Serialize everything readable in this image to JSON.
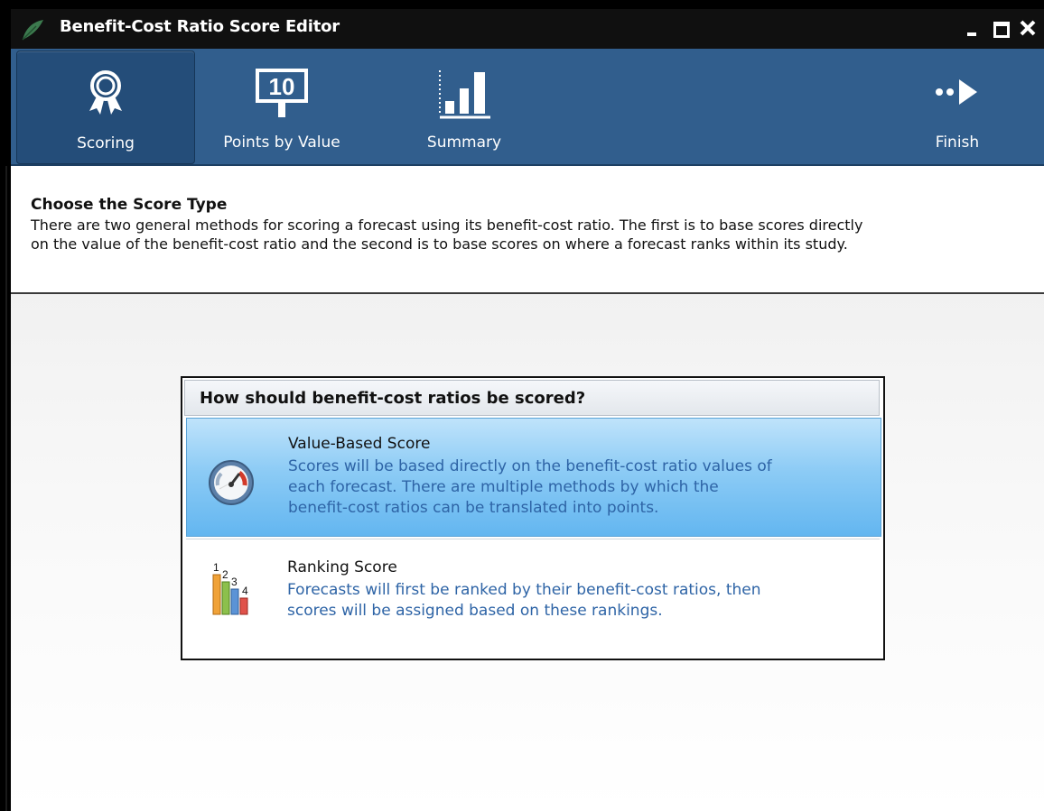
{
  "window": {
    "title": "Benefit-Cost Ratio Score Editor",
    "minimize_glyph": "_",
    "maximize_glyph": "□",
    "close_glyph": "✕"
  },
  "ribbon": {
    "items": [
      {
        "label": "Scoring",
        "icon": "award-ribbon-icon",
        "selected": true
      },
      {
        "label": "Points by Value",
        "icon": "ten-points-sign-icon",
        "selected": false
      },
      {
        "label": "Summary",
        "icon": "bar-chart-icon",
        "selected": false
      },
      {
        "label": "Finish",
        "icon": "dots-arrow-right-icon",
        "selected": false
      }
    ]
  },
  "header": {
    "title": "Choose the Score Type",
    "description_line1": "There are two general methods for scoring a forecast using its benefit-cost ratio. The first is to base scores directly",
    "description_line2": "on the value of the benefit-cost ratio and the second is to base scores on where a forecast ranks within its study."
  },
  "panel": {
    "question": "How should benefit-cost ratios be scored?",
    "options": [
      {
        "title": "Value-Based Score",
        "description_line1": "Scores will be based directly on the benefit-cost ratio values of",
        "description_line2": "each forecast. There are multiple methods by which the",
        "description_line3": "benefit-cost ratios can be translated into points.",
        "icon": "gauge-icon",
        "selected": true
      },
      {
        "title": "Ranking Score",
        "description_line1": "Forecasts will first be ranked by their benefit-cost ratios, then",
        "description_line2": "scores will be assigned based on these rankings.",
        "icon": "ranked-bars-icon",
        "rank_numbers": [
          "1",
          "2",
          "3",
          "4"
        ],
        "selected": false
      }
    ]
  },
  "colors": {
    "ribbon_bg": "#315e8d",
    "ribbon_selected": "#244d79",
    "selected_option": "#8ccbf5",
    "description_text": "#2e64a6"
  }
}
